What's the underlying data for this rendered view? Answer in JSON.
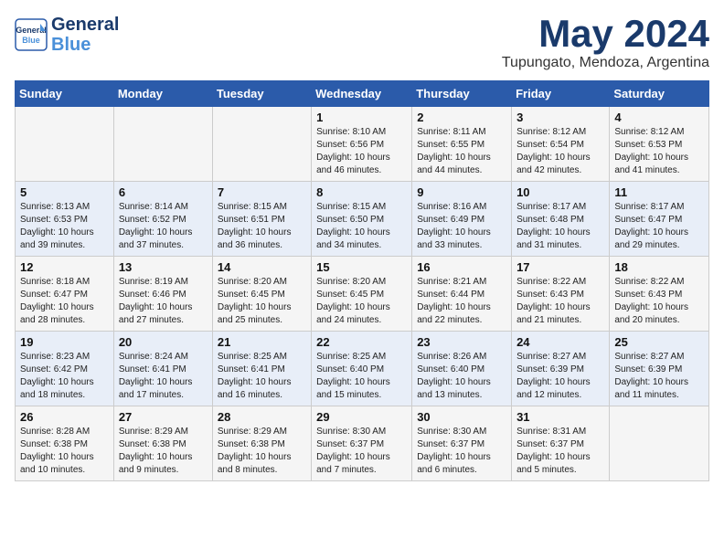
{
  "header": {
    "logo_line1": "General",
    "logo_line2": "Blue",
    "title": "May 2024",
    "location": "Tupungato, Mendoza, Argentina"
  },
  "columns": [
    "Sunday",
    "Monday",
    "Tuesday",
    "Wednesday",
    "Thursday",
    "Friday",
    "Saturday"
  ],
  "weeks": [
    [
      {
        "day": "",
        "info": ""
      },
      {
        "day": "",
        "info": ""
      },
      {
        "day": "",
        "info": ""
      },
      {
        "day": "1",
        "info": "Sunrise: 8:10 AM\nSunset: 6:56 PM\nDaylight: 10 hours\nand 46 minutes."
      },
      {
        "day": "2",
        "info": "Sunrise: 8:11 AM\nSunset: 6:55 PM\nDaylight: 10 hours\nand 44 minutes."
      },
      {
        "day": "3",
        "info": "Sunrise: 8:12 AM\nSunset: 6:54 PM\nDaylight: 10 hours\nand 42 minutes."
      },
      {
        "day": "4",
        "info": "Sunrise: 8:12 AM\nSunset: 6:53 PM\nDaylight: 10 hours\nand 41 minutes."
      }
    ],
    [
      {
        "day": "5",
        "info": "Sunrise: 8:13 AM\nSunset: 6:53 PM\nDaylight: 10 hours\nand 39 minutes."
      },
      {
        "day": "6",
        "info": "Sunrise: 8:14 AM\nSunset: 6:52 PM\nDaylight: 10 hours\nand 37 minutes."
      },
      {
        "day": "7",
        "info": "Sunrise: 8:15 AM\nSunset: 6:51 PM\nDaylight: 10 hours\nand 36 minutes."
      },
      {
        "day": "8",
        "info": "Sunrise: 8:15 AM\nSunset: 6:50 PM\nDaylight: 10 hours\nand 34 minutes."
      },
      {
        "day": "9",
        "info": "Sunrise: 8:16 AM\nSunset: 6:49 PM\nDaylight: 10 hours\nand 33 minutes."
      },
      {
        "day": "10",
        "info": "Sunrise: 8:17 AM\nSunset: 6:48 PM\nDaylight: 10 hours\nand 31 minutes."
      },
      {
        "day": "11",
        "info": "Sunrise: 8:17 AM\nSunset: 6:47 PM\nDaylight: 10 hours\nand 29 minutes."
      }
    ],
    [
      {
        "day": "12",
        "info": "Sunrise: 8:18 AM\nSunset: 6:47 PM\nDaylight: 10 hours\nand 28 minutes."
      },
      {
        "day": "13",
        "info": "Sunrise: 8:19 AM\nSunset: 6:46 PM\nDaylight: 10 hours\nand 27 minutes."
      },
      {
        "day": "14",
        "info": "Sunrise: 8:20 AM\nSunset: 6:45 PM\nDaylight: 10 hours\nand 25 minutes."
      },
      {
        "day": "15",
        "info": "Sunrise: 8:20 AM\nSunset: 6:45 PM\nDaylight: 10 hours\nand 24 minutes."
      },
      {
        "day": "16",
        "info": "Sunrise: 8:21 AM\nSunset: 6:44 PM\nDaylight: 10 hours\nand 22 minutes."
      },
      {
        "day": "17",
        "info": "Sunrise: 8:22 AM\nSunset: 6:43 PM\nDaylight: 10 hours\nand 21 minutes."
      },
      {
        "day": "18",
        "info": "Sunrise: 8:22 AM\nSunset: 6:43 PM\nDaylight: 10 hours\nand 20 minutes."
      }
    ],
    [
      {
        "day": "19",
        "info": "Sunrise: 8:23 AM\nSunset: 6:42 PM\nDaylight: 10 hours\nand 18 minutes."
      },
      {
        "day": "20",
        "info": "Sunrise: 8:24 AM\nSunset: 6:41 PM\nDaylight: 10 hours\nand 17 minutes."
      },
      {
        "day": "21",
        "info": "Sunrise: 8:25 AM\nSunset: 6:41 PM\nDaylight: 10 hours\nand 16 minutes."
      },
      {
        "day": "22",
        "info": "Sunrise: 8:25 AM\nSunset: 6:40 PM\nDaylight: 10 hours\nand 15 minutes."
      },
      {
        "day": "23",
        "info": "Sunrise: 8:26 AM\nSunset: 6:40 PM\nDaylight: 10 hours\nand 13 minutes."
      },
      {
        "day": "24",
        "info": "Sunrise: 8:27 AM\nSunset: 6:39 PM\nDaylight: 10 hours\nand 12 minutes."
      },
      {
        "day": "25",
        "info": "Sunrise: 8:27 AM\nSunset: 6:39 PM\nDaylight: 10 hours\nand 11 minutes."
      }
    ],
    [
      {
        "day": "26",
        "info": "Sunrise: 8:28 AM\nSunset: 6:38 PM\nDaylight: 10 hours\nand 10 minutes."
      },
      {
        "day": "27",
        "info": "Sunrise: 8:29 AM\nSunset: 6:38 PM\nDaylight: 10 hours\nand 9 minutes."
      },
      {
        "day": "28",
        "info": "Sunrise: 8:29 AM\nSunset: 6:38 PM\nDaylight: 10 hours\nand 8 minutes."
      },
      {
        "day": "29",
        "info": "Sunrise: 8:30 AM\nSunset: 6:37 PM\nDaylight: 10 hours\nand 7 minutes."
      },
      {
        "day": "30",
        "info": "Sunrise: 8:30 AM\nSunset: 6:37 PM\nDaylight: 10 hours\nand 6 minutes."
      },
      {
        "day": "31",
        "info": "Sunrise: 8:31 AM\nSunset: 6:37 PM\nDaylight: 10 hours\nand 5 minutes."
      },
      {
        "day": "",
        "info": ""
      }
    ]
  ]
}
